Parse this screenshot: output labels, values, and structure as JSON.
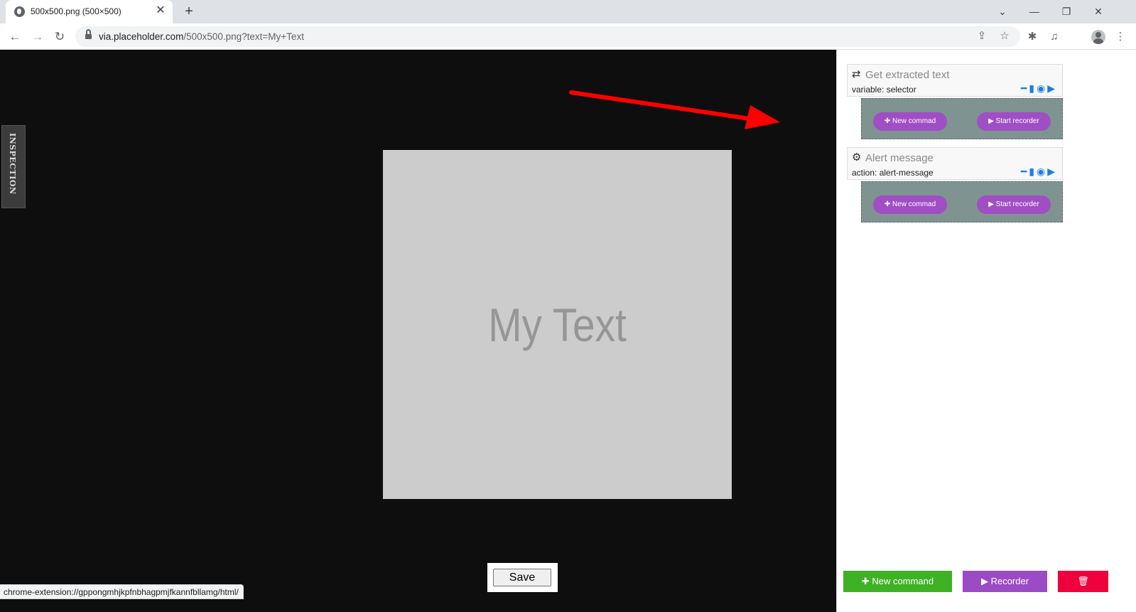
{
  "browser": {
    "tab_title": "500x500.png (500×500)",
    "tab_close": "✕",
    "new_tab": "+",
    "window_controls": {
      "tab_search": "⌄",
      "minimize": "—",
      "restore": "❐",
      "close": "✕"
    },
    "url_host": "via.placeholder.com",
    "url_path": "/500x500.png?text=My+Text",
    "nav": {
      "back": "←",
      "forward": "→",
      "reload": "↻"
    },
    "toolbar_icons": {
      "share": "⇪",
      "bookmark": "☆",
      "extensions": "✱",
      "media": "♫",
      "menu": "⋮"
    }
  },
  "page": {
    "inspection_label": "INSPECTION",
    "image_text": "My Text",
    "save_label": "Save",
    "status_url": "chrome-extension://gppongmhjkpfnbhagpmjfkannfbllamg/html/",
    "arrow_color": "#ff0000"
  },
  "panel": {
    "commands": [
      {
        "icon": "⇄",
        "title": "Get extracted text",
        "subtitle": "variable: selector",
        "new_label": "New commad",
        "rec_label": "Start recorder"
      },
      {
        "icon": "⚙",
        "title": "Alert message",
        "subtitle": "action: alert-message",
        "new_label": "New commad",
        "rec_label": "Start recorder"
      }
    ],
    "actions": {
      "remove": "━",
      "copy": "▮",
      "view": "◉",
      "step": "▶"
    },
    "bottom": {
      "new_command": "New command",
      "recorder": "Recorder",
      "new_icon": "✚",
      "rec_icon": "▶",
      "delete_icon": "🗑"
    },
    "colors": {
      "green": "#3fb124",
      "purple": "#9b4bc4",
      "red": "#f0003c",
      "pill": "#a04ec4",
      "dropzone": "#7f9490"
    }
  }
}
